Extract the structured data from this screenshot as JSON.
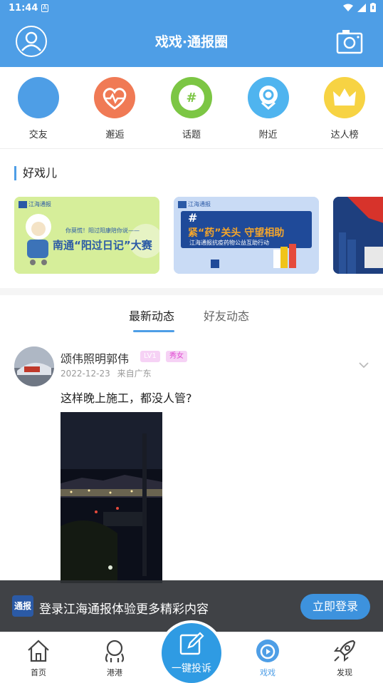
{
  "status_bar": {
    "time": "11:44",
    "a_icon": "A"
  },
  "header": {
    "title": "戏戏·通报圈"
  },
  "quick_nav": [
    {
      "label": "交友",
      "icon": "friends-icon",
      "color": "#4e9ee6"
    },
    {
      "label": "邂逅",
      "icon": "heart-pulse-icon",
      "color": "#f07a55"
    },
    {
      "label": "话题",
      "icon": "hashtag-icon",
      "color": "#7cc644"
    },
    {
      "label": "附近",
      "icon": "location-pin-icon",
      "color": "#4fb4ef"
    },
    {
      "label": "达人榜",
      "icon": "crown-icon",
      "color": "#f7d343"
    }
  ],
  "section": {
    "title": "好戏儿"
  },
  "banners": [
    {
      "brand": "江海通报",
      "caption": "你莫慌！阳过阳康陪你说——",
      "title": "南通“阳过日记”大赛"
    },
    {
      "brand": "江海通报",
      "hash": "#",
      "title": "紧“药”关头 守望相助",
      "subtitle": "江海通报抗疫药物公益互助行动"
    },
    {
      "brand": "",
      "title": ""
    }
  ],
  "tabs": [
    {
      "label": "最新动态",
      "active": true
    },
    {
      "label": "好友动态",
      "active": false
    }
  ],
  "post": {
    "author": "颂伟照明郭伟",
    "level": "LV1",
    "tag": "秀女",
    "date": "2022-12-23",
    "location": "来自广东",
    "text": "这样晚上施工，都没人管?"
  },
  "login_prompt": {
    "logo": "通报",
    "text": "登录江海通报体验更多精彩内容",
    "button": "立即登录"
  },
  "bottom_nav": [
    {
      "label": "首页",
      "icon": "home-icon",
      "active": false
    },
    {
      "label": "港港",
      "icon": "mascot-icon",
      "active": false
    },
    {
      "label": "一键投诉",
      "icon": "edit-icon",
      "active": false
    },
    {
      "label": "戏戏",
      "icon": "play-circle-icon",
      "active": true
    },
    {
      "label": "发现",
      "icon": "rocket-icon",
      "active": false
    }
  ],
  "colors": {
    "primary": "#4e9ee6",
    "active_tab_text": "#222222",
    "inactive_tab_text": "#666666"
  }
}
